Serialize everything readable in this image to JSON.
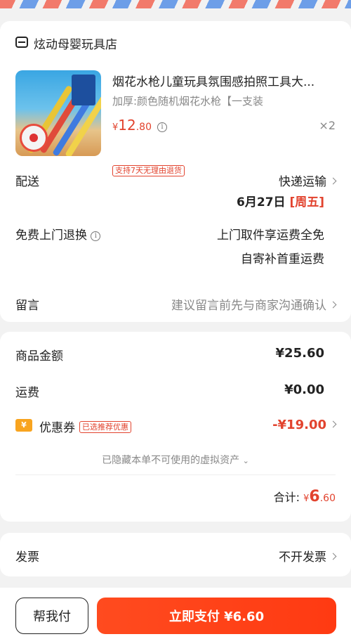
{
  "store": {
    "name": "炫动母婴玩具店",
    "icon": "store-icon"
  },
  "product": {
    "title": "烟花水枪儿童玩具氛围感拍照工具大...",
    "spec": "加厚:颜色随机烟花水枪【一支装",
    "price_symbol": "¥",
    "price_int": "12",
    "price_dec": ".80",
    "quantity": "×2",
    "tag": "支持7天无理由退货"
  },
  "delivery": {
    "label": "配送",
    "method": "快递运输",
    "date": "6月27日",
    "weekday": "[周五]"
  },
  "return": {
    "label": "免费上门退换",
    "line1": "上门取件享运费全免",
    "line2": "自寄补首重运费"
  },
  "message": {
    "label": "留言",
    "placeholder": "建议留言前先与商家沟通确认"
  },
  "summary": {
    "goods_label": "商品金额",
    "goods_value": "¥25.60",
    "shipping_label": "运费",
    "shipping_value": "¥0.00",
    "coupon_label": "优惠券",
    "coupon_tag": "已选推荐优惠",
    "coupon_value": "-¥19.00",
    "hidden_note": "已隐藏本单不可使用的虚拟资产",
    "total_label": "合计:",
    "total_symbol": "¥",
    "total_int": "6",
    "total_dec": ".60"
  },
  "invoice": {
    "label": "发票",
    "value": "不开发票"
  },
  "footer": {
    "help_label": "帮我付",
    "pay_label": "立即支付 ¥6.60"
  },
  "colors": {
    "accent": "#ff3a12",
    "price_red": "#e2432e",
    "coupon_orange": "#f8a41f"
  }
}
